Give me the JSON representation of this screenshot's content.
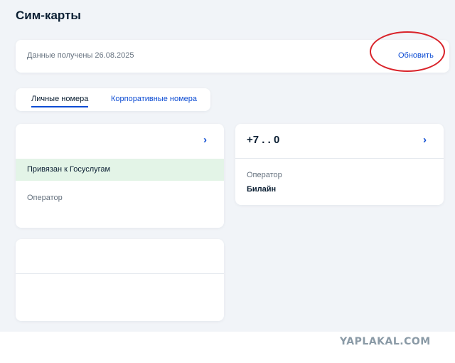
{
  "page": {
    "title": "Сим-карты"
  },
  "info": {
    "received_text": "Данные получены 26.08.2025",
    "update_label": "Обновить"
  },
  "tabs": [
    {
      "label": "Личные номера",
      "active": true
    },
    {
      "label": "Корпоративные номера",
      "active": false
    }
  ],
  "sim_cards": [
    {
      "number": "",
      "status": "Привязан к Госуслугам",
      "operator_label": "Оператор",
      "operator": ""
    },
    {
      "number": "+7 . . 0",
      "status": "",
      "operator_label": "Оператор",
      "operator": "Билайн"
    }
  ],
  "colors": {
    "accent": "#0d4cd3",
    "linked_bg": "#e3f4e7",
    "annotation": "#d9232a",
    "page_bg": "#f1f4f8"
  },
  "icons": {
    "card_chevron": "chevron-right-icon"
  },
  "watermark": "YAPLAKAL.COM"
}
